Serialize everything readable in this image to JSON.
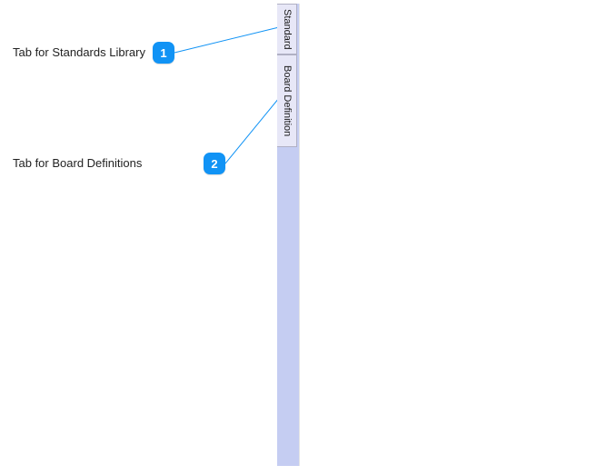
{
  "panel": {
    "tabs": {
      "standard": {
        "label": "Standard"
      },
      "board_definition": {
        "label": "Board Definition"
      }
    }
  },
  "callouts": {
    "c1": {
      "number": "1",
      "text": "Tab for Standards Library"
    },
    "c2": {
      "number": "2",
      "text": "Tab for Board Definitions"
    }
  }
}
